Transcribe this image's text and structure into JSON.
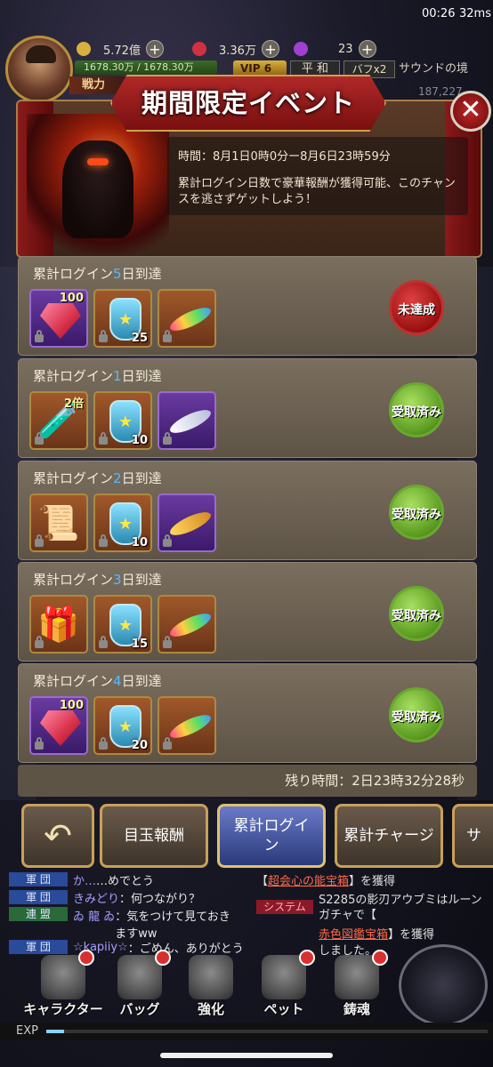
{
  "status_bar": {
    "time": "00:26",
    "network": "32ms"
  },
  "hud": {
    "gold": "5.72億",
    "gems": "3.36万",
    "diamond": "23",
    "hp": "1678.30万 / 1678.30万",
    "vip": "VIP 6",
    "mode": "平 和",
    "buff": "バフx2",
    "sound": "サウンドの境",
    "power_label": "戦力",
    "power_value": "187,227"
  },
  "event": {
    "title": "期間限定イベント",
    "time_text": "時間：8月1日0時0分ー8月6日23時59分",
    "description": "累計ログイン日数で豪華報酬が獲得可能、このチャンスを逃さずゲットしよう！",
    "remaining": "残り時間：2日23時32分28秒"
  },
  "rows": [
    {
      "prefix": "累計ログイン",
      "day": "5",
      "suffix": "日到達",
      "status": "未達成",
      "status_color": "red",
      "items": [
        {
          "kind": "gem",
          "frame": "purple",
          "tag": "100",
          "qty": ""
        },
        {
          "kind": "bottle",
          "frame": "orange",
          "tag": "",
          "qty": "25"
        },
        {
          "kind": "feather-rainbow",
          "frame": "orange",
          "tag": "",
          "qty": ""
        }
      ]
    },
    {
      "prefix": "累計ログイン",
      "day": "1",
      "suffix": "日到達",
      "status": "受取済み",
      "status_color": "green",
      "items": [
        {
          "kind": "potion",
          "frame": "orange",
          "tag": "2倍",
          "qty": ""
        },
        {
          "kind": "bottle",
          "frame": "orange",
          "tag": "",
          "qty": "10"
        },
        {
          "kind": "feather-white",
          "frame": "purple",
          "tag": "",
          "qty": ""
        }
      ]
    },
    {
      "prefix": "累計ログイン",
      "day": "2",
      "suffix": "日到達",
      "status": "受取済み",
      "status_color": "green",
      "items": [
        {
          "kind": "scroll",
          "frame": "orange",
          "tag": "",
          "qty": ""
        },
        {
          "kind": "bottle",
          "frame": "orange",
          "tag": "",
          "qty": "10"
        },
        {
          "kind": "feather-gold",
          "frame": "purple",
          "tag": "",
          "qty": ""
        }
      ]
    },
    {
      "prefix": "累計ログイン",
      "day": "3",
      "suffix": "日到達",
      "status": "受取済み",
      "status_color": "green",
      "items": [
        {
          "kind": "giftbox",
          "frame": "orange",
          "tag": "",
          "qty": ""
        },
        {
          "kind": "bottle",
          "frame": "orange",
          "tag": "",
          "qty": "15"
        },
        {
          "kind": "feather-rainbow",
          "frame": "orange",
          "tag": "",
          "qty": ""
        }
      ]
    },
    {
      "prefix": "累計ログイン",
      "day": "4",
      "suffix": "日到達",
      "status": "受取済み",
      "status_color": "green",
      "items": [
        {
          "kind": "gem",
          "frame": "purple",
          "tag": "100",
          "qty": ""
        },
        {
          "kind": "bottle",
          "frame": "orange",
          "tag": "",
          "qty": "20"
        },
        {
          "kind": "feather-rainbow",
          "frame": "orange",
          "tag": "",
          "qty": ""
        }
      ]
    }
  ],
  "tabs": [
    {
      "label": "目玉報酬",
      "active": false
    },
    {
      "label": "累計ログイン",
      "active": true
    },
    {
      "label": "累計チャージ",
      "active": false
    },
    {
      "label": "サ",
      "active": false
    }
  ],
  "chat": [
    {
      "channel": "軍 団",
      "channel_color": "blue",
      "name": "か…",
      "msg": "…めでとう"
    },
    {
      "channel": "軍 団",
      "channel_color": "blue",
      "name": "きみどり",
      "msg": "：何つながり？"
    },
    {
      "channel": "連 盟",
      "channel_color": "green",
      "name": "ゐ 龍 ゐ",
      "msg": "：気をつけて見ておきますww"
    },
    {
      "channel": "軍 団",
      "channel_color": "blue",
      "name": "☆kapiiy☆",
      "msg": "：ごめん、ありがとう"
    }
  ],
  "system_chat": {
    "line1_prefix": "【",
    "line1_item": "超会心の能宝箱",
    "line1_suffix": "】を獲得",
    "tag": "システム",
    "line2": "S2285の影刃アウブミはルーンガチャで【",
    "line3_item": "赤色図鑑宝箱",
    "line3_suffix": "】を獲得",
    "line4": "しました。"
  },
  "bottom_nav": [
    {
      "label": "キャラクター",
      "dot": true
    },
    {
      "label": "バッグ",
      "dot": true
    },
    {
      "label": "強化",
      "dot": false
    },
    {
      "label": "ペット",
      "dot": true
    },
    {
      "label": "鋳魂",
      "dot": true
    }
  ],
  "exp": {
    "label": "EXP",
    "fraction": 0.04
  },
  "colors": {
    "accent_gold": "#c8a058",
    "status_green": "#5a9a20",
    "status_red": "#9a1010",
    "day_number": "#5ab8ff"
  }
}
